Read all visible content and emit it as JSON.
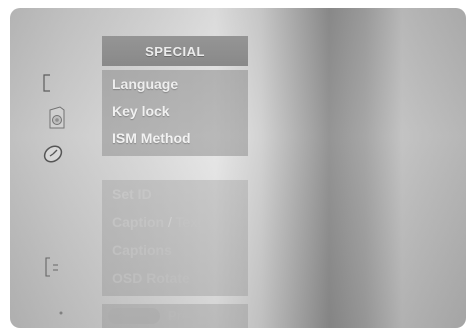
{
  "menu": {
    "title": "SPECIAL",
    "group1": [
      "Language",
      "Key lock",
      "ISM Method"
    ],
    "group2": {
      "set_id": "Set ID",
      "caption_text_a": "Caption",
      "caption_text_slash": " / ",
      "caption_text_b": "Text",
      "captions": "Captions",
      "osd_rotate": "OSD Rotate"
    }
  },
  "footer": {
    "label": "Pre"
  },
  "icons": [
    "picture-icon",
    "sound-icon",
    "time-icon",
    "special-icon",
    "screen-icon",
    "bullet-icon"
  ],
  "colors": {
    "header": "#8f8f8f",
    "active_text": "#f2f2f2",
    "dim_text": "#c9c9c9"
  }
}
